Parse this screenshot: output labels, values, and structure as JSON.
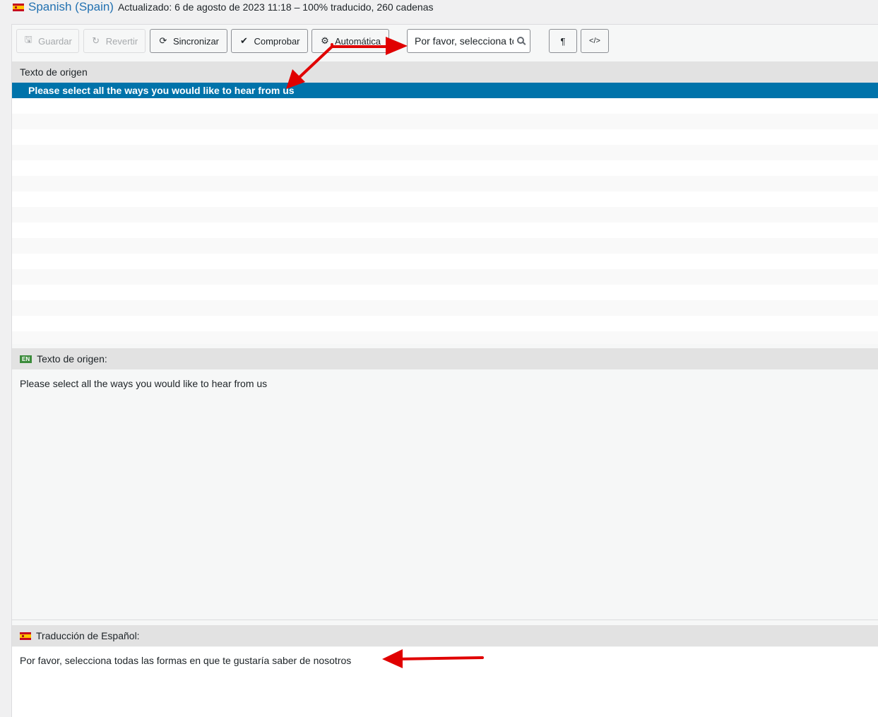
{
  "header": {
    "language_name": "Spanish (Spain)",
    "meta": "Actualizado: 6 de agosto de 2023 11:18 – 100% traducido, 260 cadenas"
  },
  "toolbar": {
    "save_label": "Guardar",
    "revert_label": "Revertir",
    "sync_label": "Sincronizar",
    "check_label": "Comprobar",
    "auto_label": "Automática",
    "search_value": "Por favor, selecciona to",
    "pilcrow_label": "¶",
    "code_label": "</>"
  },
  "source_list": {
    "header": "Texto de origen",
    "selected_string": "Please select all the ways you would like to hear from us"
  },
  "source_panel": {
    "badge": "EN",
    "header": "Texto de origen:",
    "text": "Please select all the ways you would like to hear from us"
  },
  "translation_panel": {
    "header": "Traducción de Español:",
    "text": "Por favor, selecciona todas las formas en que te gustaría saber de nosotros"
  },
  "colors": {
    "accent": "#2271b1",
    "selected_row": "#0073aa",
    "annotation_arrow": "#e00000"
  }
}
